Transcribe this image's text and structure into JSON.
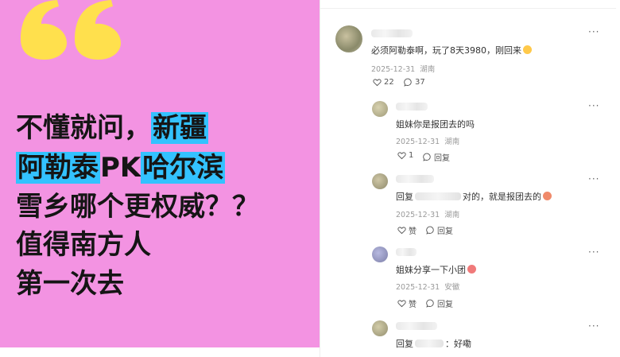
{
  "post": {
    "headline_lines": [
      [
        "不懂就问，",
        "新疆"
      ],
      [
        "阿勒泰",
        "PK",
        "哈尔滨"
      ],
      [
        "雪乡哪个更权威？？"
      ],
      [
        "值得南方人"
      ],
      [
        "第一次去"
      ]
    ],
    "highlight_color": "#33c2ff",
    "background_color": "#f393e2",
    "quote_color": "#ffe04d"
  },
  "comments": [
    {
      "text": "必须阿勒泰啊，玩了8天3980，刚回来",
      "date": "2025-12-31",
      "location": "湖南",
      "likes": "22",
      "replies": "37",
      "more": "···",
      "emoji": "smiling-face-with-tear-emoji"
    },
    {
      "text": "姐妹你是报团去的吗",
      "date": "2025-12-31",
      "location": "湖南",
      "likes": "1",
      "reply_label": "回复",
      "more": "···"
    },
    {
      "reply_prefix": "回复",
      "text": "对的，就是报团去的",
      "date": "2025-12-31",
      "location": "湖南",
      "like_label": "赞",
      "reply_label": "回复",
      "more": "···",
      "emoji": "face-emoji"
    },
    {
      "text": "姐妹分享一下小团",
      "date": "2025-12-31",
      "location": "安徽",
      "like_label": "赞",
      "reply_label": "回复",
      "more": "···",
      "emoji": "face-emoji"
    },
    {
      "reply_prefix": "回复",
      "text": "：好嘞",
      "more": "···"
    }
  ]
}
